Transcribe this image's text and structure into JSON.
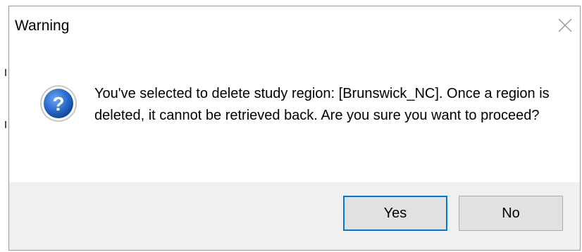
{
  "window": {
    "title": "Warning",
    "close_icon": "close-x-icon"
  },
  "message": {
    "icon": "question-icon",
    "text": "You've selected to delete study region: [Brunswick_NC]. Once a region is deleted, it cannot be retrieved back. Are you sure you want to proceed?"
  },
  "buttons": {
    "yes_label": "Yes",
    "no_label": "No"
  },
  "colors": {
    "accent": "#0078d7",
    "button_face": "#e1e1e1",
    "footer_bg": "#f0f0f0",
    "icon_blue": "#1c5fbd"
  }
}
